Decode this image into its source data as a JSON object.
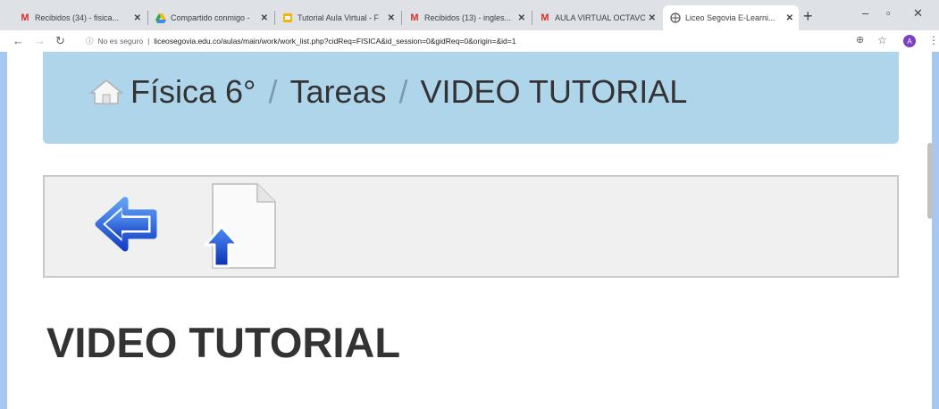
{
  "tabs": [
    {
      "title": "Recibidos (34) - fisica...",
      "favicon": "gmail-icon"
    },
    {
      "title": "Compartido conmigo -",
      "favicon": "drive-icon"
    },
    {
      "title": "Tutorial Aula Virtual - F",
      "favicon": "slides-icon"
    },
    {
      "title": "Recibidos (13) - ingles...",
      "favicon": "gmail-icon"
    },
    {
      "title": "AULA VIRTUAL OCTAVO",
      "favicon": "gmail-icon"
    },
    {
      "title": "Liceo Segovia E-Learni...",
      "favicon": "site-icon",
      "active": true
    }
  ],
  "address_bar": {
    "security": "No es seguro",
    "url": "liceosegovia.edu.co/aulas/main/work/work_list.php?cidReq=FISICA&id_session=0&gidReq=0&origin=&id=1"
  },
  "profile_initial": "A",
  "breadcrumb": {
    "items": [
      "Física 6°",
      "Tareas",
      "VIDEO TUTORIAL"
    ],
    "separator": "/"
  },
  "page": {
    "heading": "VIDEO TUTORIAL"
  },
  "colors": {
    "breadcrumb_bg": "#aed5ea",
    "toolbar_panel_bg": "#f0f0f0",
    "heading_text": "#333333",
    "icon_blue": "#1a5fd6"
  }
}
